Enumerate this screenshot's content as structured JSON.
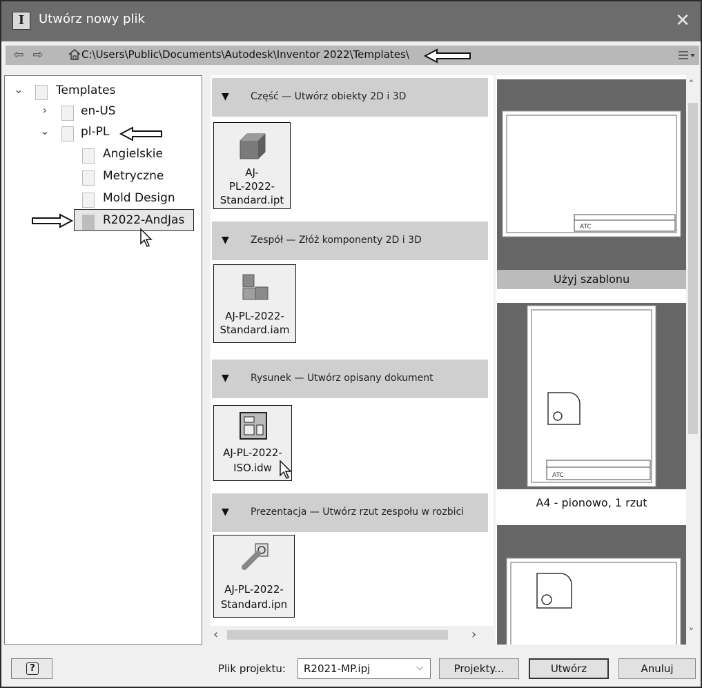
{
  "window": {
    "title": "Utwórz nowy plik",
    "app_icon": "I",
    "close_icon": "✕"
  },
  "pathbar": {
    "path": "C:\\Users\\Public\\Documents\\Autodesk\\Inventor 2022\\Templates\\"
  },
  "tree": {
    "root": "Templates",
    "items": [
      {
        "label": "en-US"
      },
      {
        "label": "pl-PL"
      },
      {
        "label": "Angielskie"
      },
      {
        "label": "Metryczne"
      },
      {
        "label": "Mold Design"
      },
      {
        "label": "R2022-AndJas"
      }
    ]
  },
  "sections": [
    {
      "header": "Część — Utwórz obiekty 2D i 3D",
      "file": [
        "AJ-",
        "PL-2022-",
        "Standard.ipt"
      ]
    },
    {
      "header": "Zespół — Złóż komponenty 2D i 3D",
      "file": [
        "AJ-PL-2022-",
        "Standard.iam"
      ]
    },
    {
      "header": "Rysunek — Utwórz opisany dokument",
      "file": [
        "AJ-PL-2022-",
        "ISO.idw"
      ]
    },
    {
      "header": "Prezentacja — Utwórz rzut zespołu w rozbici",
      "file": [
        "AJ-PL-2022-",
        "Standard.ipn"
      ]
    }
  ],
  "previews": {
    "use_template": "Użyj szablonu",
    "a4_portrait": "A4 - pionowo, 1 rzut"
  },
  "footer": {
    "help": "?",
    "project_label": "Plik projektu:",
    "project_value": "R2021-MP.ipj",
    "projects_button": "Projekty...",
    "create_button": "Utwórz",
    "cancel_button": "Anuluj"
  },
  "colors": {
    "titlebar": "#6c6c6c",
    "section_header": "#cfcfcf",
    "pathbar": "#b8b8b8"
  }
}
